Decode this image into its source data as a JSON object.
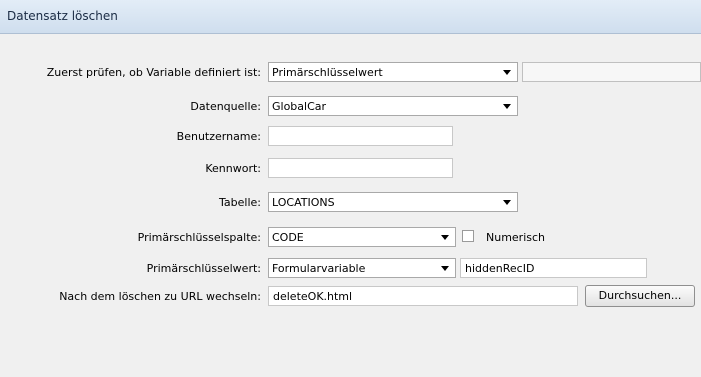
{
  "dialog": {
    "title": "Datensatz löschen"
  },
  "form": {
    "check_variable": {
      "label": "Zuerst prüfen, ob Variable definiert ist:",
      "value": "Primärschlüsselwert",
      "text_value": ""
    },
    "datasource": {
      "label": "Datenquelle:",
      "value": "GlobalCar"
    },
    "username": {
      "label": "Benutzername:",
      "value": ""
    },
    "password": {
      "label": "Kennwort:",
      "value": ""
    },
    "table": {
      "label": "Tabelle:",
      "value": "LOCATIONS"
    },
    "pk_column": {
      "label": "Primärschlüsselspalte:",
      "value": "CODE",
      "numeric_label": "Numerisch",
      "numeric_checked": false
    },
    "pk_value": {
      "label": "Primärschlüsselwert:",
      "value": "Formularvariable",
      "text_value": "hiddenRecID"
    },
    "redirect_url": {
      "label": "Nach dem löschen zu URL wechseln:",
      "value": "deleteOK.html",
      "browse_label": "Durchsuchen..."
    }
  }
}
